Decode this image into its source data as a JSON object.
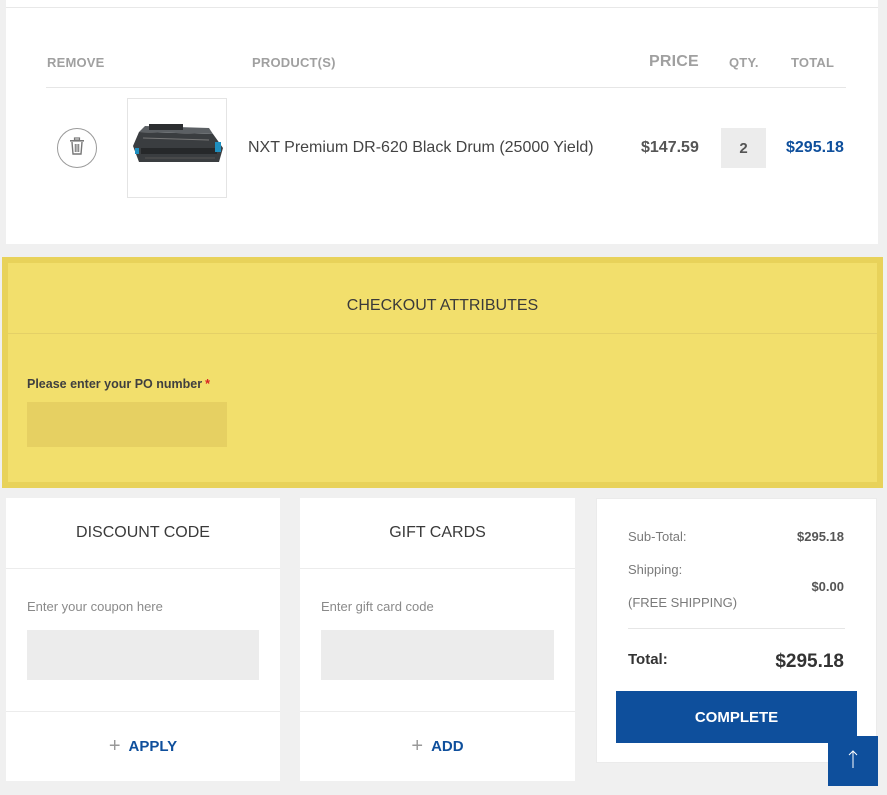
{
  "cart": {
    "headers": {
      "remove": "REMOVE",
      "products": "PRODUCT(S)",
      "price": "PRICE",
      "qty": "QTY.",
      "total": "TOTAL"
    },
    "item": {
      "name": "NXT Premium DR-620 Black Drum (25000 Yield)",
      "unit_price": "$147.59",
      "quantity": "2",
      "total": "$295.18",
      "remove_icon": "trash-icon",
      "image_icon": "drum-unit-image"
    }
  },
  "checkout_attributes": {
    "title": "CHECKOUT ATTRIBUTES",
    "po_label": "Please enter your PO number",
    "required_mark": "*",
    "po_value": ""
  },
  "discount": {
    "title": "DISCOUNT CODE",
    "hint": "Enter your coupon here",
    "value": "",
    "button": "APPLY"
  },
  "gift_cards": {
    "title": "GIFT CARDS",
    "hint": "Enter gift card code",
    "value": "",
    "button": "ADD"
  },
  "totals": {
    "subtotal_label": "Sub-Total:",
    "subtotal_value": "$295.18",
    "shipping_label": "Shipping:",
    "shipping_note": "(FREE SHIPPING)",
    "shipping_value": "$0.00",
    "total_label": "Total:",
    "total_value": "$295.18",
    "complete_button": "COMPLETE"
  },
  "colors": {
    "accent": "#0e4f9c",
    "attributes_bg": "#f2df6c",
    "required": "#d92020"
  },
  "scroll_top_icon": "arrow-up-icon"
}
